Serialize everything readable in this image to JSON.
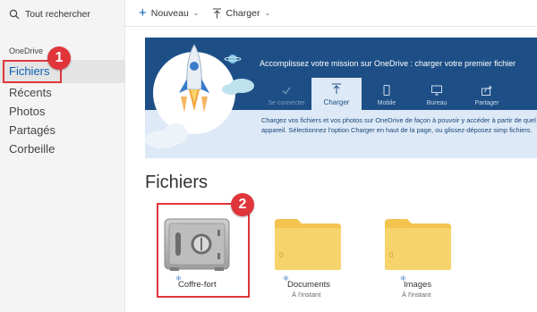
{
  "search": {
    "label": "Tout rechercher"
  },
  "toolbar": {
    "new_label": "Nouveau",
    "upload_label": "Charger"
  },
  "nav": {
    "section": "OneDrive",
    "items": [
      {
        "label": "Fichiers",
        "active": true
      },
      {
        "label": "Récents"
      },
      {
        "label": "Photos"
      },
      {
        "label": "Partagés"
      },
      {
        "label": "Corbeille"
      }
    ]
  },
  "banner": {
    "title": "Accomplissez votre mission sur OneDrive : charger votre premier fichier",
    "tabs": [
      {
        "label": "Se connecter",
        "icon": "check-icon",
        "state": "done"
      },
      {
        "label": "Charger",
        "icon": "upload-icon",
        "state": "active"
      },
      {
        "label": "Mobile",
        "icon": "phone-icon"
      },
      {
        "label": "Bureau",
        "icon": "monitor-icon"
      },
      {
        "label": "Partager",
        "icon": "share-icon"
      }
    ],
    "text": "Chargez vos fichiers et vos photos sur OneDrive de façon à pouvoir y accéder à partir de quel appareil. Sélectionnez l'option Charger en haut de la page, ou glissez-déposez simp fichiers."
  },
  "files": {
    "title": "Fichiers",
    "items": [
      {
        "name": "Coffre-fort",
        "sub": "",
        "type": "vault"
      },
      {
        "name": "Documents",
        "sub": "À l'instant",
        "count": "0",
        "type": "folder"
      },
      {
        "name": "Images",
        "sub": "À l'instant",
        "count": "0",
        "type": "folder"
      }
    ]
  },
  "annotations": {
    "badge1": "1",
    "badge2": "2"
  },
  "colors": {
    "accent": "#0a5fb2",
    "banner_dark": "#1d4f86",
    "banner_light": "#dde9f7",
    "annotation_red": "#e0353b",
    "folder": "#f7d36b"
  }
}
